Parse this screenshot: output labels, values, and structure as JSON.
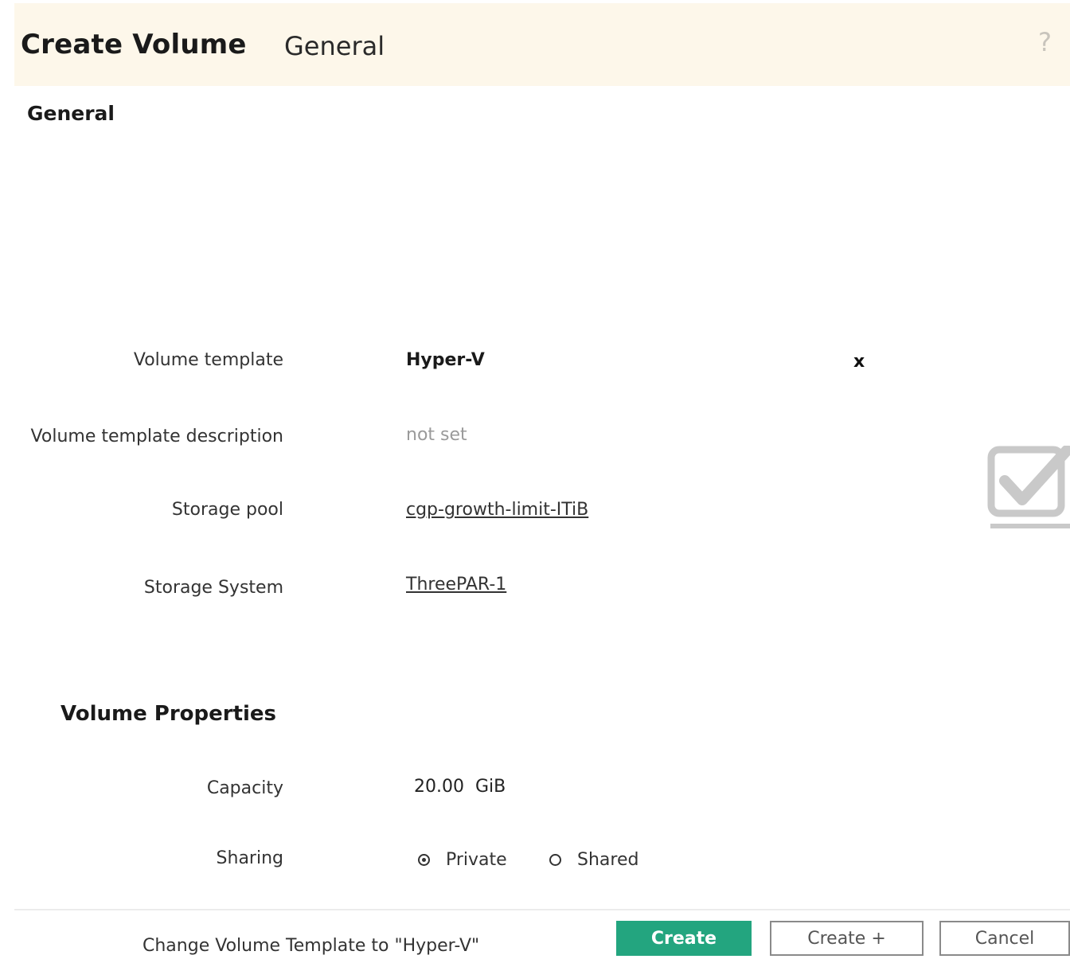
{
  "header": {
    "title": "Create Volume",
    "subtitle": "General",
    "help_icon": "?"
  },
  "general": {
    "section_title": "General",
    "fields": {
      "volume_template": {
        "label": "Volume template",
        "value": "Hyper-V",
        "clear_symbol": "x"
      },
      "template_description": {
        "label": "Volume template description",
        "value": "not set"
      },
      "storage_pool": {
        "label": "Storage pool",
        "value": "cgp-growth-limit-ITiB"
      },
      "storage_system": {
        "label": "Storage System",
        "value": "ThreePAR-1"
      }
    }
  },
  "volume_properties": {
    "section_title": "Volume Properties",
    "capacity": {
      "label": "Capacity",
      "value": "20.00  GiB"
    },
    "sharing": {
      "label": "Sharing",
      "options": [
        {
          "label": "Private",
          "selected": true
        },
        {
          "label": "Shared",
          "selected": false
        }
      ]
    }
  },
  "footer": {
    "message": "Change Volume Template to \"Hyper-V\"",
    "buttons": {
      "create": "Create",
      "create_plus": "Create +",
      "cancel": "Cancel"
    }
  },
  "icons": {
    "help": "question-icon",
    "clear": "close-icon",
    "status": "checkmark-icon"
  },
  "colors": {
    "header_bg": "#fdf7ea",
    "primary_button": "#23a57f",
    "checkmark": "#c9c9c9"
  }
}
